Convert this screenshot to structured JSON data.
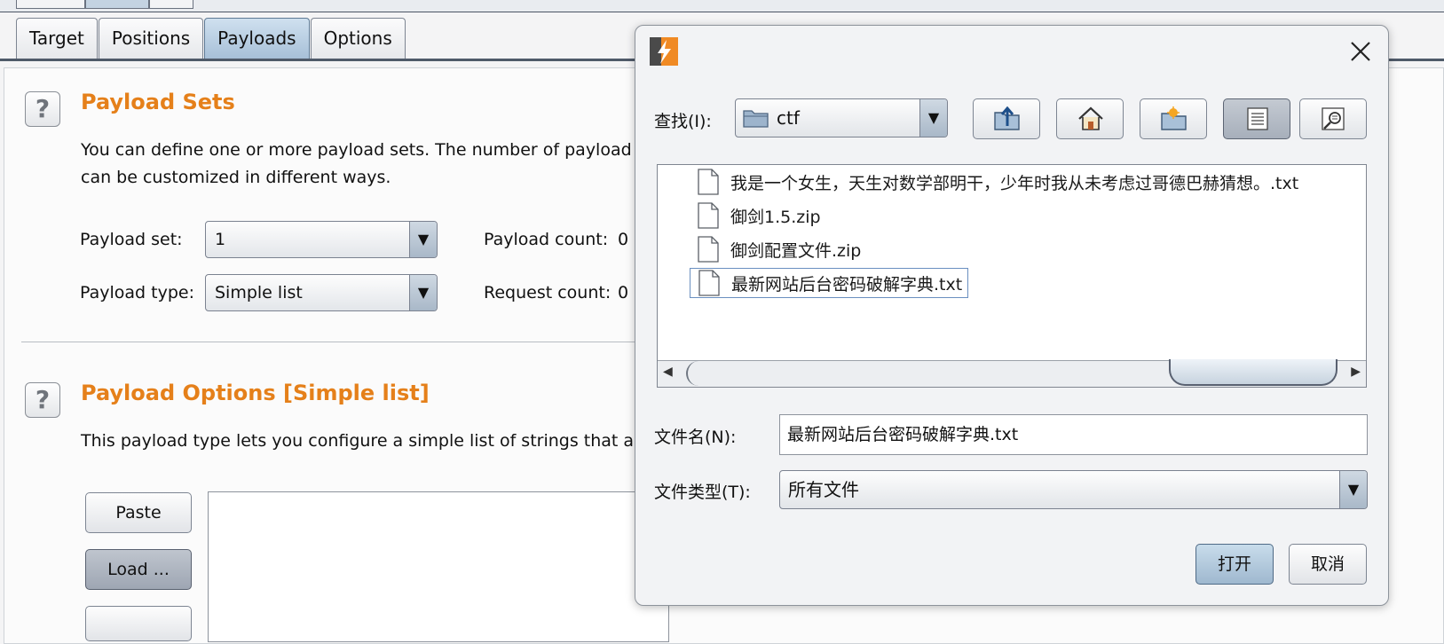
{
  "tabs": [
    {
      "label": "Target"
    },
    {
      "label": "Positions"
    },
    {
      "label": "Payloads",
      "active": true
    },
    {
      "label": "Options"
    }
  ],
  "payload_sets": {
    "help": "?",
    "heading": "Payload Sets",
    "desc_line1": "You can define one or more payload sets. The number of payload s",
    "desc_line2": "can be customized in different ways.",
    "set_label": "Payload set:",
    "set_value": "1",
    "count_label": "Payload count:",
    "count_value": "0",
    "type_label": "Payload type:",
    "type_value": "Simple list",
    "request_label": "Request count:",
    "request_value": "0"
  },
  "payload_options": {
    "help": "?",
    "heading": "Payload Options [Simple list]",
    "desc": "This payload type lets you configure a simple list of strings that are",
    "buttons": {
      "paste": "Paste",
      "load": "Load ..."
    }
  },
  "dialog": {
    "look_in_label": "查找(I):",
    "look_in_value": "ctf",
    "toolbar": [
      "up-folder-icon",
      "home-icon",
      "new-folder-icon",
      "list-view-icon",
      "details-view-icon"
    ],
    "files": [
      {
        "name": "我是一个女生，天生对数学部明干，少年时我从未考虑过哥德巴赫猜想。.txt"
      },
      {
        "name": "御剑1.5.zip"
      },
      {
        "name": "御剑配置文件.zip"
      },
      {
        "name": "最新网站后台密码破解字典.txt",
        "selected": true
      }
    ],
    "filename_label": "文件名(N):",
    "filename_value": "最新网站后台密码破解字典.txt",
    "filetype_label": "文件类型(T):",
    "filetype_value": "所有文件",
    "open_button": "打开",
    "cancel_button": "取消"
  },
  "colors": {
    "heading_orange": "#e5801a",
    "tab_active": "#a7c0d8",
    "logo_orange": "#f08a24"
  }
}
